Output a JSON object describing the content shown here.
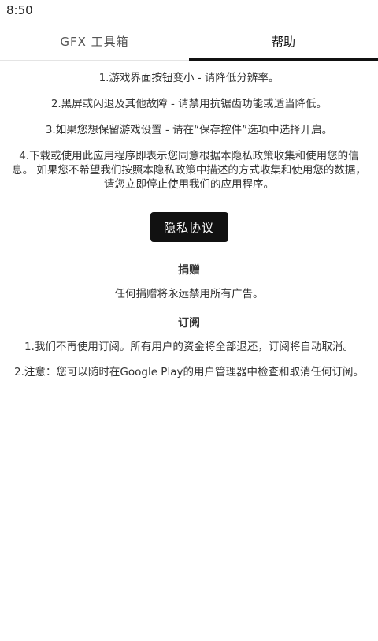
{
  "status_bar": {
    "time": "8:50"
  },
  "tabs": [
    {
      "label": "GFX 工具箱",
      "selected": false
    },
    {
      "label": "帮助",
      "selected": true
    }
  ],
  "help": {
    "items": [
      "1.游戏界面按钮变小 - 请降低分辨率。",
      "2.黑屏或闪退及其他故障 - 请禁用抗锯齿功能或适当降低。",
      "3.如果您想保留游戏设置 - 请在“保存控件”选项中选择开启。",
      "4.下载或使用此应用程序即表示您同意根据本隐私政策收集和使用您的信息。 如果您不希望我们按照本隐私政策中描述的方式收集和使用您的数据，请您立即停止使用我们的应用程序。"
    ],
    "privacy_button": "隐私协议"
  },
  "donate": {
    "title": "捐赠",
    "text": "任何捐赠将永远禁用所有广告。"
  },
  "subscription": {
    "title": "订阅",
    "items": [
      "1.我们不再使用订阅。所有用户的资金将全部退还，订阅将自动取消。",
      "2.注意：您可以随时在Google Play的用户管理器中检查和取消任何订阅。"
    ]
  },
  "colors": {
    "accent": "#111111",
    "background": "#ffffff",
    "text": "#333333"
  }
}
